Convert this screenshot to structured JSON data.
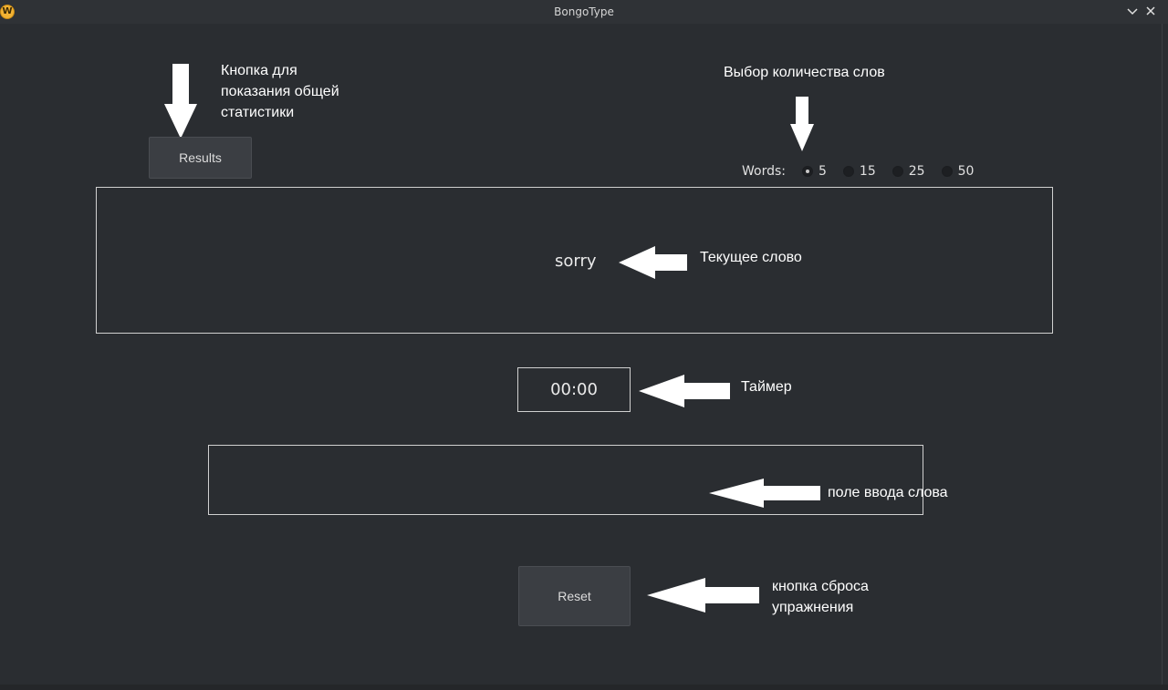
{
  "window": {
    "title": "BongoType",
    "app_icon_letter": "W"
  },
  "results_button": {
    "label": "Results"
  },
  "words_selector": {
    "label": "Words:",
    "options": [
      {
        "label": "5",
        "selected": true
      },
      {
        "label": "15",
        "selected": false
      },
      {
        "label": "25",
        "selected": false
      },
      {
        "label": "50",
        "selected": false
      }
    ]
  },
  "current_word": "sorry",
  "timer": "00:00",
  "word_input": {
    "value": ""
  },
  "reset_button": {
    "label": "Reset"
  },
  "annotations": {
    "results": "Кнопка для\nпоказания общей\nстатистики",
    "words": "Выбор количества слов",
    "current_word": "Текущее слово",
    "timer": "Таймер",
    "input": "поле ввода слова",
    "reset": "кнопка сброса\nупражнения"
  },
  "icons": [
    "app-icon",
    "chevron-down-icon",
    "close-icon",
    "arrow-down-icon",
    "arrow-left-icon"
  ]
}
